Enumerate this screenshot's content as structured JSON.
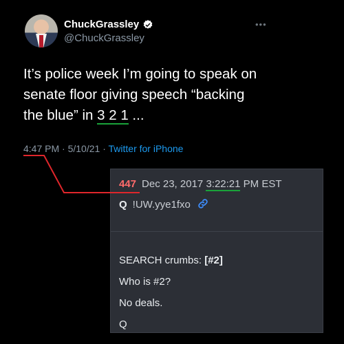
{
  "tweet": {
    "display_name": "ChuckGrassley",
    "handle": "@ChuckGrassley",
    "verified_icon": "verified-badge-icon",
    "more_icon": "more-options-icon",
    "text_line1": "It’s police week I’m going to speak on",
    "text_line2": "senate floor giving speech “backing",
    "text_line3_pre": "the blue” in ",
    "text_line3_mark": "3 2 1",
    "text_line3_post": " ...",
    "time": "4:47 PM",
    "sep1": " · ",
    "date": "5/10/21",
    "sep2": " · ",
    "source": "Twitter for iPhone"
  },
  "q_post": {
    "number": "447",
    "date": "Dec 23, 2017",
    "time": "3:22:21",
    "tz": "PM EST",
    "q_letter": "Q",
    "tripcode": "!UW.yye1fxo",
    "link_icon": "link-icon",
    "body_line1_pre": "SEARCH crumbs: ",
    "body_line1_bold": "[#2]",
    "body_line2": "Who is #2?",
    "body_line3": "No deals.",
    "body_line4": "Q"
  },
  "colors": {
    "background": "#000000",
    "card": "#2c2f36",
    "link_blue": "#1d9bf0",
    "underline_green": "#1aa33a",
    "annotation_red": "#e0262b"
  }
}
